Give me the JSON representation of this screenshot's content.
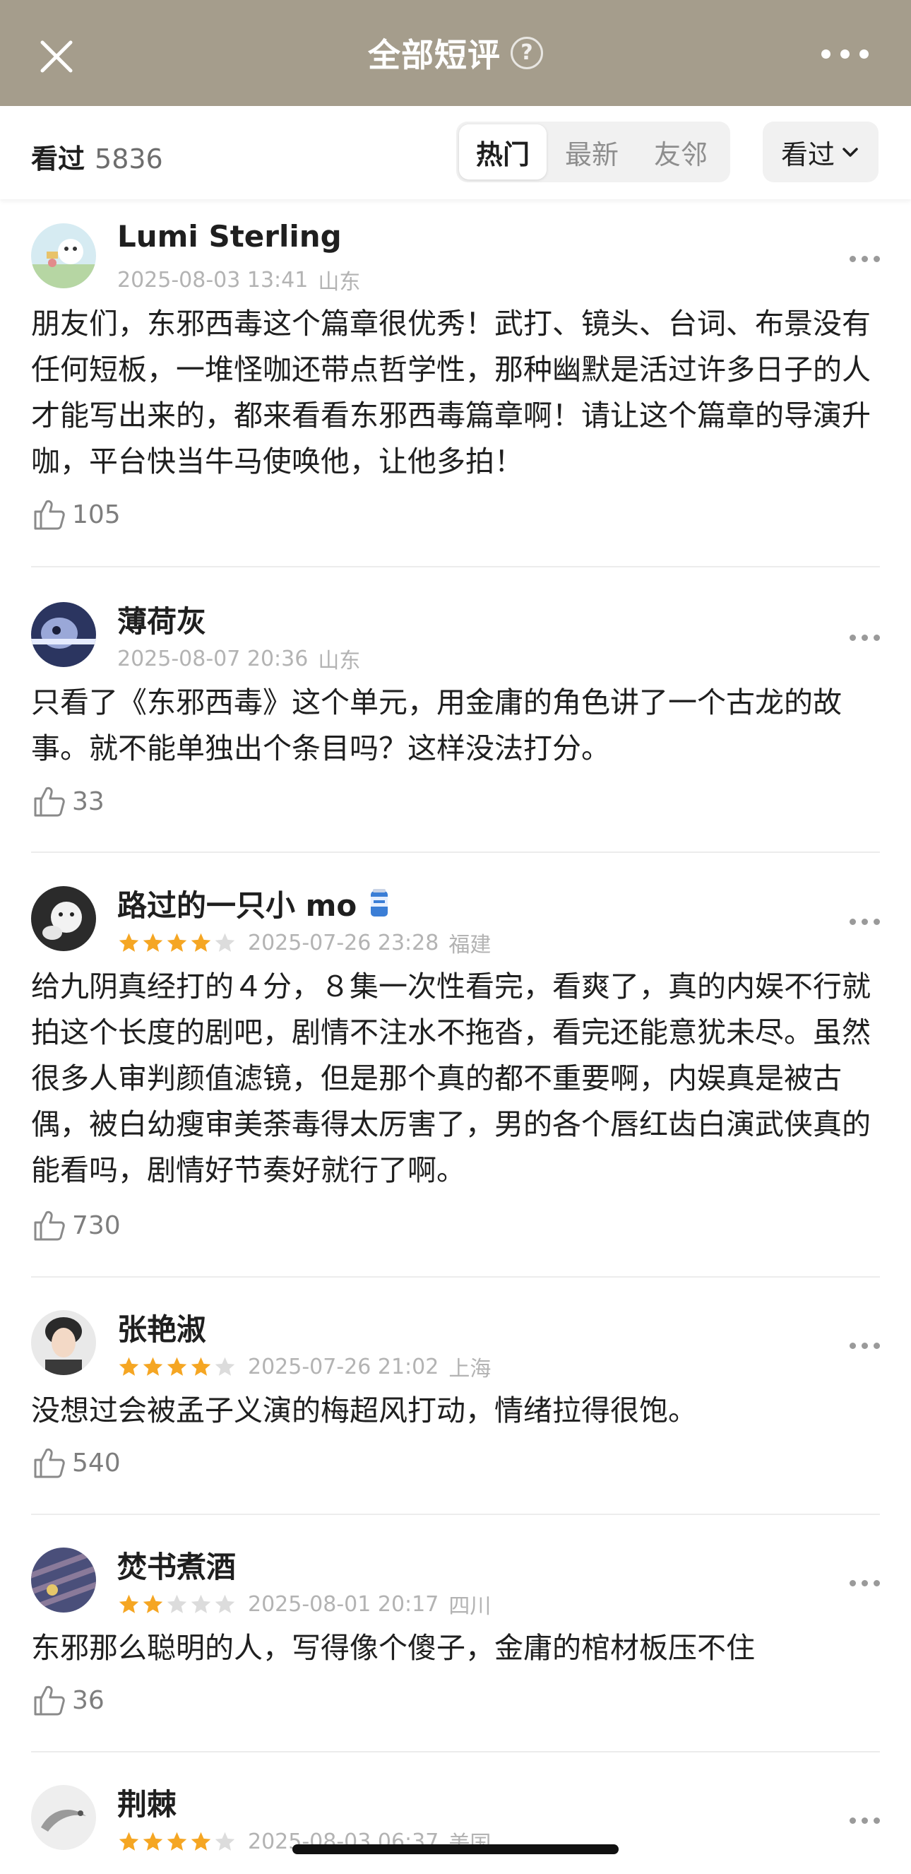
{
  "header": {
    "title": "全部短评",
    "help_glyph": "?",
    "bg_color": "#a59d8c"
  },
  "filter": {
    "watched_label": "看过",
    "watched_count": "5836",
    "tabs": [
      "热门",
      "最新",
      "友邻"
    ],
    "active_tab": "热门",
    "dropdown_label": "看过"
  },
  "reviews": [
    {
      "user": "Lumi Sterling",
      "rating": null,
      "date": "2025-08-03 13:41",
      "location": "山东",
      "text": "朋友们，东邪西毒这个篇章很优秀！武打、镜头、台词、布景没有任何短板，一堆怪咖还带点哲学性，那种幽默是活过许多日子的人才能写出来的，都来看看东邪西毒篇章啊！请让这个篇章的导演升咖，平台快当牛马使唤他，让他多拍！",
      "likes": "105"
    },
    {
      "user": "薄荷灰",
      "rating": null,
      "date": "2025-08-07 20:36",
      "location": "山东",
      "text": "只看了《东邪西毒》这个单元，用金庸的角色讲了一个古龙的故事。就不能单独出个条目吗？这样没法打分。",
      "likes": "33"
    },
    {
      "user": "路过的一只小 mo",
      "badge_icon": "beer-can-icon",
      "rating": 4,
      "date": "2025-07-26 23:28",
      "location": "福建",
      "text": "给九阴真经打的４分，８集一次性看完，看爽了，真的内娱不行就拍这个长度的剧吧，剧情不注水不拖沓，看完还能意犹未尽。虽然很多人审判颜值滤镜，但是那个真的都不重要啊，内娱真是被古偶，被白幼瘦审美荼毒得太厉害了，男的各个唇红齿白演武侠真的能看吗，剧情好节奏好就行了啊。",
      "likes": "730"
    },
    {
      "user": "张艳淑",
      "rating": 4,
      "date": "2025-07-26 21:02",
      "location": "上海",
      "text": "没想过会被孟子义演的梅超风打动，情绪拉得很饱。",
      "likes": "540"
    },
    {
      "user": "焚书煮酒",
      "rating": 2,
      "date": "2025-08-01 20:17",
      "location": "四川",
      "text": "东邪那么聪明的人，写得像个傻子，金庸的棺材板压不住",
      "likes": "36"
    },
    {
      "user": "荆棘",
      "rating": 4,
      "date": "2025-08-03 06:37",
      "location": "美国",
      "text": "",
      "likes": ""
    }
  ],
  "colors": {
    "star_on": "#f5a623",
    "star_off": "#dcdcdc",
    "meta_text": "#b3b3b3"
  }
}
